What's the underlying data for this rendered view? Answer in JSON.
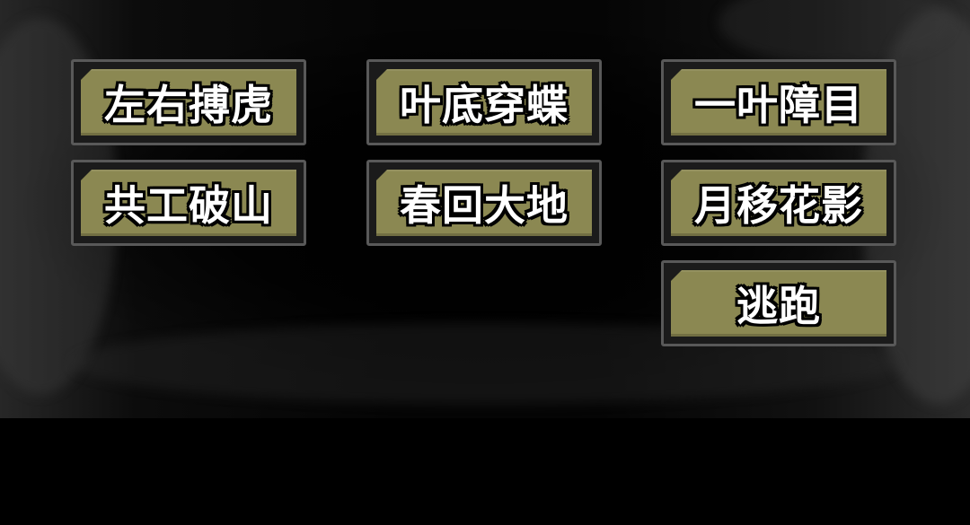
{
  "skills": {
    "row1": [
      "左右搏虎",
      "叶底穿蝶",
      "一叶障目"
    ],
    "row2": [
      "共工破山",
      "春回大地",
      "月移花影"
    ]
  },
  "escape": {
    "label": "逃跑"
  },
  "colors": {
    "button_face": "#8b8852",
    "button_border": "#595959",
    "background": "#000000"
  }
}
